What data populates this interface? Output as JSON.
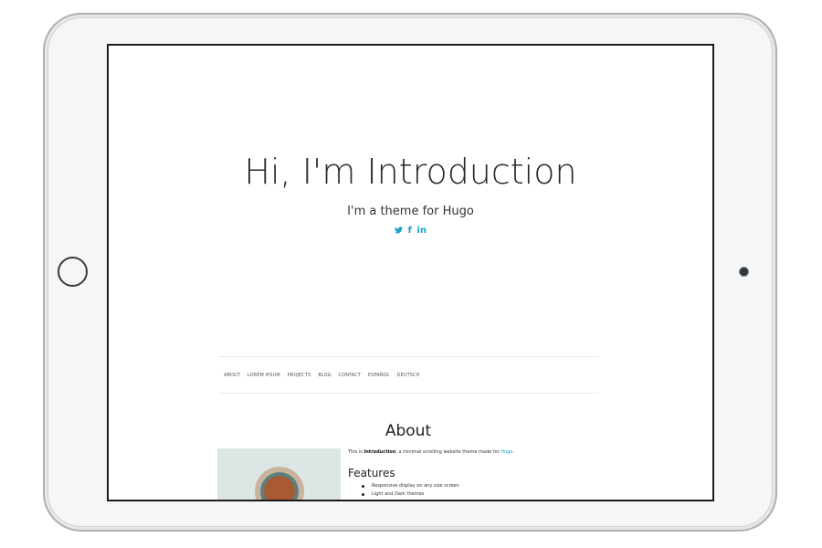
{
  "hero": {
    "title": "Hi, I'm Introduction",
    "subtitle": "I'm a theme for Hugo",
    "social": [
      {
        "icon": "twitter-icon",
        "glyph": "🐦"
      },
      {
        "icon": "facebook-icon",
        "glyph": "f"
      },
      {
        "icon": "linkedin-icon",
        "glyph": "in"
      }
    ]
  },
  "nav": {
    "items": [
      "ABOUT",
      "LOREM IPSUM",
      "PROJECTS",
      "BLOG",
      "CONTACT",
      "ESPAÑOL",
      "DEUTSCH"
    ]
  },
  "about": {
    "title": "About",
    "intro_prefix": "This is ",
    "intro_bold": "Introduction",
    "intro_middle": ", a minimal scrolling website theme made for ",
    "intro_link": "Hugo",
    "intro_suffix": ".",
    "features_title": "Features",
    "features": [
      "Responsive display on any size screen",
      "Light and Dark themes"
    ]
  },
  "colors": {
    "accent": "#1aa1c8",
    "text": "#2a2a2a",
    "device_frame": "#f5f6f8"
  }
}
